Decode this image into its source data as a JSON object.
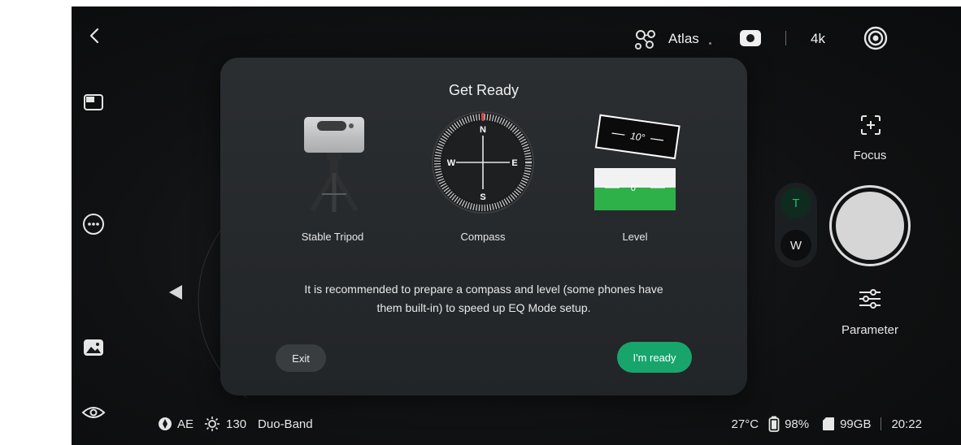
{
  "top_bar": {
    "atlas_label": "Atlas",
    "resolution_label": "4k"
  },
  "modal": {
    "title": "Get Ready",
    "items": [
      {
        "label": "Stable Tripod"
      },
      {
        "label": "Compass"
      },
      {
        "label": "Level"
      }
    ],
    "compass": {
      "n": "N",
      "s": "S",
      "e": "E",
      "w": "W"
    },
    "level": {
      "top_reading": "10°",
      "bottom_reading": "0°"
    },
    "description_line1": "It is recommended to prepare a compass and level (some phones have",
    "description_line2": "them built-in) to speed up EQ Mode setup.",
    "exit_label": "Exit",
    "ready_label": "I'm ready"
  },
  "right_panel": {
    "focus_label": "Focus",
    "tele_label": "T",
    "wide_label": "W",
    "parameter_label": "Parameter"
  },
  "bottom_bar": {
    "ae_label": "AE",
    "brightness_value": "130",
    "band_label": "Duo-Band",
    "temperature": "27°C",
    "battery": "98%",
    "storage": "99GB",
    "time": "20:22"
  },
  "colors": {
    "accent_green": "#17a56c",
    "tele_green": "#1fbf6a",
    "modal_bg": "#2b2e31"
  }
}
